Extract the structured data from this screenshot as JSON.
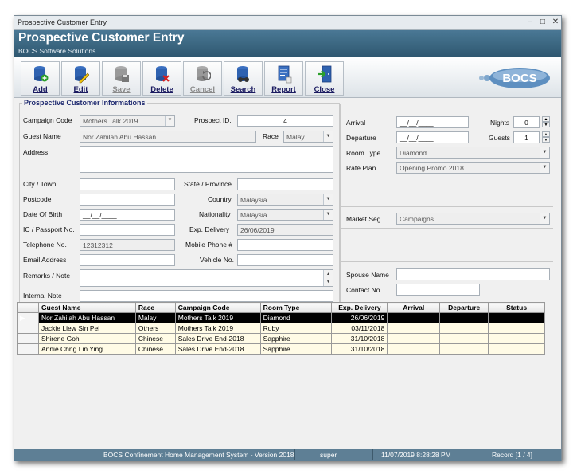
{
  "window": {
    "title": "Prospective Customer Entry",
    "header_title": "Prospective Customer Entry",
    "header_subtitle": "BOCS Software Solutions"
  },
  "toolbar": {
    "add": "Add",
    "edit": "Edit",
    "save": "Save",
    "delete": "Delete",
    "cancel": "Cancel",
    "search": "Search",
    "report": "Report",
    "close": "Close",
    "logo": "BOCS"
  },
  "form": {
    "section_title": "Prospective Customer Informations",
    "campaign_code": {
      "label": "Campaign Code",
      "value": "Mothers Talk 2019"
    },
    "prospect_id": {
      "label": "Prospect ID.",
      "value": "4"
    },
    "guest_name": {
      "label": "Guest Name",
      "value": "Nor Zahilah Abu Hassan"
    },
    "race": {
      "label": "Race",
      "value": "Malay"
    },
    "address": {
      "label": "Address",
      "value": ""
    },
    "city": {
      "label": "City / Town",
      "value": ""
    },
    "state": {
      "label": "State / Province",
      "value": ""
    },
    "postcode": {
      "label": "Postcode",
      "value": ""
    },
    "country": {
      "label": "Country",
      "value": "Malaysia"
    },
    "dob": {
      "label": "Date Of Birth",
      "value": "__/__/____"
    },
    "nationality": {
      "label": "Nationality",
      "value": "Malaysia"
    },
    "ic": {
      "label": "IC / Passport No.",
      "value": ""
    },
    "exp_delivery": {
      "label": "Exp. Delivery",
      "value": "26/06/2019"
    },
    "telephone": {
      "label": "Telephone No.",
      "value": "12312312"
    },
    "mobile": {
      "label": "Mobile Phone #",
      "value": ""
    },
    "email": {
      "label": "Email Address",
      "value": ""
    },
    "vehicle": {
      "label": "Vehicle No.",
      "value": ""
    },
    "remarks": {
      "label": "Remarks / Note",
      "value": ""
    },
    "internal_note": {
      "label": "Internal Note",
      "value": ""
    }
  },
  "booking": {
    "arrival": {
      "label": "Arrival",
      "value": "__/__/____"
    },
    "departure": {
      "label": "Departure",
      "value": "__/__/____"
    },
    "nights": {
      "label": "Nights",
      "value": "0"
    },
    "guests": {
      "label": "Guests",
      "value": "1"
    },
    "room_type": {
      "label": "Room Type",
      "value": "Diamond"
    },
    "rate_plan": {
      "label": "Rate Plan",
      "value": "Opening Promo 2018"
    },
    "market_seg": {
      "label": "Market Seg.",
      "value": "Campaigns"
    },
    "spouse_name": {
      "label": "Spouse Name",
      "value": ""
    },
    "contact_no": {
      "label": "Contact No.",
      "value": ""
    }
  },
  "grid": {
    "columns": [
      "Guest Name",
      "Race",
      "Campaign Code",
      "Room Type",
      "Exp. Delivery",
      "Arrival",
      "Departure",
      "Status"
    ],
    "rows": [
      [
        "Nor Zahilah Abu Hassan",
        "Malay",
        "Mothers Talk 2019",
        "Diamond",
        "26/06/2019",
        "",
        "",
        ""
      ],
      [
        "Jackie Liew Sin Pei",
        "Others",
        "Mothers Talk 2019",
        "Ruby",
        "03/11/2018",
        "",
        "",
        ""
      ],
      [
        "Shirene Goh",
        "Chinese",
        "Sales Drive End-2018",
        "Sapphire",
        "31/10/2018",
        "",
        "",
        ""
      ],
      [
        "Annie Chng Lin Ying",
        "Chinese",
        "Sales Drive End-2018",
        "Sapphire",
        "31/10/2018",
        "",
        "",
        ""
      ]
    ],
    "current_marker": "▶"
  },
  "status": {
    "system": "BOCS Confinement Home Management System - Version 2018",
    "user": "super",
    "datetime": "11/07/2019 8:28:28 PM",
    "record": "Record   [1 / 4]"
  },
  "colors": {
    "header": "#2f5870",
    "statusbar": "#5e7f95",
    "label_blue": "#1a1a60"
  }
}
